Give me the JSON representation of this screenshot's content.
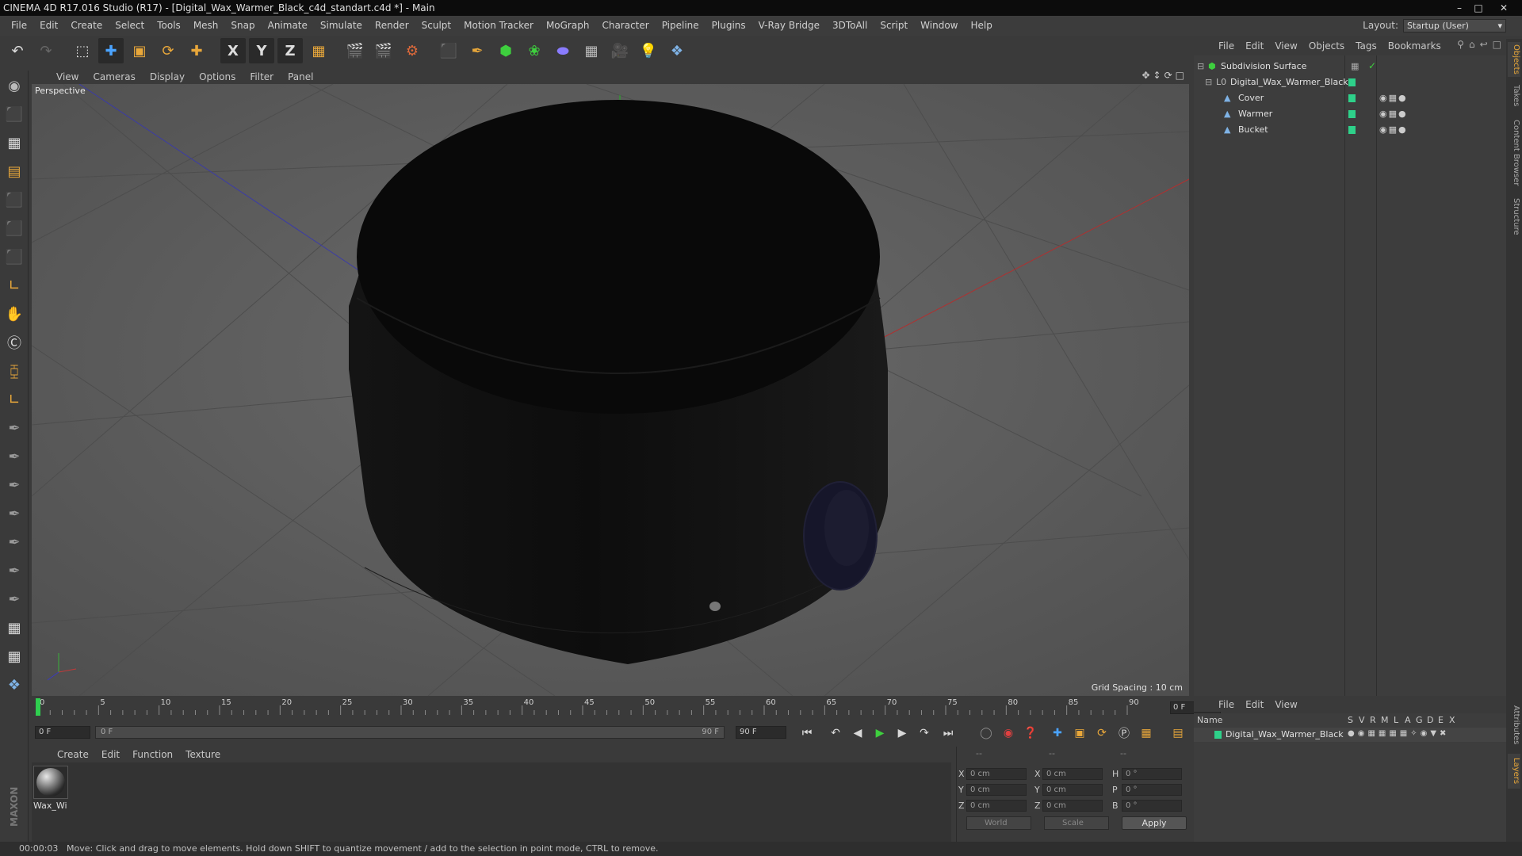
{
  "window": {
    "title": "CINEMA 4D R17.016 Studio (R17) - [Digital_Wax_Warmer_Black_c4d_standart.c4d *] - Main",
    "buttons": [
      "minimize",
      "maximize",
      "close"
    ]
  },
  "menubar": {
    "items": [
      "File",
      "Edit",
      "Create",
      "Select",
      "Tools",
      "Mesh",
      "Snap",
      "Animate",
      "Simulate",
      "Render",
      "Sculpt",
      "Motion Tracker",
      "MoGraph",
      "Character",
      "Pipeline",
      "Plugins",
      "V-Ray Bridge",
      "3DToAll",
      "Script",
      "Window",
      "Help"
    ],
    "layout_label": "Layout:",
    "layout_value": "Startup (User)"
  },
  "toolbar": {
    "icons": [
      "undo-icon",
      "redo-icon",
      "live-selection-icon",
      "move-icon",
      "scale-icon",
      "rotate-icon",
      "move-plus-icon",
      "x-axis-icon",
      "y-axis-icon",
      "z-axis-icon",
      "coordinate-system-icon",
      "render-view-icon",
      "render-picture-viewer-icon",
      "render-settings-icon",
      "cube-icon",
      "pen-icon",
      "subdivision-icon",
      "cloner-icon",
      "deformer-icon",
      "floor-icon",
      "camera-icon",
      "light-icon",
      "python-icon"
    ],
    "axis_labels": [
      "X",
      "Y",
      "Z"
    ]
  },
  "viewport": {
    "menu": [
      "View",
      "Cameras",
      "Display",
      "Options",
      "Filter",
      "Panel"
    ],
    "label": "Perspective",
    "grid_spacing": "Grid Spacing : 10 cm"
  },
  "timeline": {
    "ticks": [
      "0",
      "5",
      "10",
      "15",
      "20",
      "25",
      "30",
      "35",
      "40",
      "45",
      "50",
      "55",
      "60",
      "65",
      "70",
      "75",
      "80",
      "85",
      "90"
    ],
    "end_frame": "0 F"
  },
  "transport": {
    "current_frame": "0 F",
    "range_start": "0 F",
    "range_end": "90 F",
    "max_frame": "90 F"
  },
  "material_manager": {
    "menu": [
      "Create",
      "Edit",
      "Function",
      "Texture"
    ],
    "materials": [
      {
        "name": "Wax_Wi"
      }
    ]
  },
  "coordinates": {
    "headers": [
      "--",
      "--",
      "--"
    ],
    "rows": [
      {
        "a": "X",
        "av": "0 cm",
        "b": "X",
        "bv": "0 cm",
        "c": "H",
        "cv": "0 °"
      },
      {
        "a": "Y",
        "av": "0 cm",
        "b": "Y",
        "bv": "0 cm",
        "c": "P",
        "cv": "0 °"
      },
      {
        "a": "Z",
        "av": "0 cm",
        "b": "Z",
        "bv": "0 cm",
        "c": "B",
        "cv": "0 °"
      }
    ],
    "mode": "World",
    "size_mode": "Scale",
    "apply": "Apply"
  },
  "status": {
    "time": "00:00:03",
    "message": "Move: Click and drag to move elements. Hold down SHIFT to quantize movement / add to the selection in point mode, CTRL to remove."
  },
  "object_manager": {
    "menu": [
      "File",
      "Edit",
      "View",
      "Objects",
      "Tags",
      "Bookmarks"
    ],
    "objects": [
      {
        "name": "Subdivision Surface",
        "depth": 0
      },
      {
        "name": "Digital_Wax_Warmer_Black",
        "depth": 1
      },
      {
        "name": "Cover",
        "depth": 2
      },
      {
        "name": "Warmer",
        "depth": 2
      },
      {
        "name": "Bucket",
        "depth": 2
      }
    ]
  },
  "layer_manager": {
    "menu": [
      "File",
      "Edit",
      "View"
    ],
    "columns": [
      "Name",
      "S",
      "V",
      "R",
      "M",
      "L",
      "A",
      "G",
      "D",
      "E",
      "X"
    ],
    "layers": [
      {
        "name": "Digital_Wax_Warmer_Black"
      }
    ]
  },
  "right_tabs": [
    "Objects",
    "Takes",
    "Content Browser",
    "Structure",
    "Attributes",
    "Layers"
  ],
  "branding": "MAXON CINEMA 4D",
  "colors": {
    "accent": "#e8a73a",
    "layer_green": "#2ed18a",
    "viewport_bg": "#5a5a5a"
  }
}
